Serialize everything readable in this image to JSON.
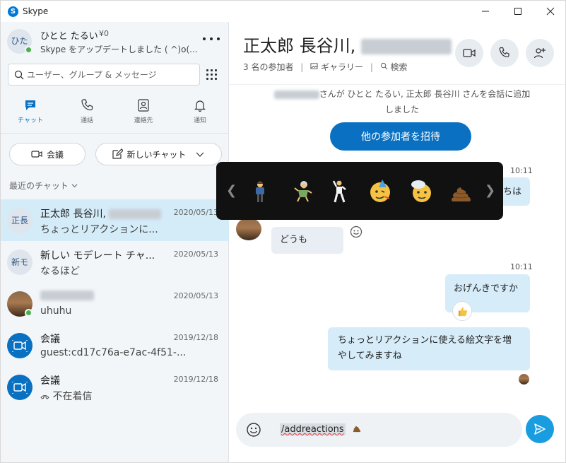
{
  "app": {
    "title": "Skype",
    "logo_letter": "S"
  },
  "profile": {
    "avatar_initials": "ひた",
    "name": "ひとと たるい",
    "credit": "¥0",
    "status": "Skype をアップデートしました ( ^)o(..."
  },
  "search": {
    "placeholder": "ユーザー、グループ & メッセージ"
  },
  "nav": [
    {
      "label": "チャット",
      "icon": "chat-icon"
    },
    {
      "label": "通話",
      "icon": "phone-icon"
    },
    {
      "label": "連絡先",
      "icon": "contacts-icon"
    },
    {
      "label": "通知",
      "icon": "bell-icon"
    }
  ],
  "actions": {
    "meeting": "会議",
    "new_chat": "新しいチャット"
  },
  "recent_label": "最近のチャット",
  "chats": [
    {
      "initials": "正長",
      "name": "正太郎 長谷川,",
      "date": "2020/05/13",
      "msg": "ちょっとリアクションに..."
    },
    {
      "initials": "新モ",
      "name": "新しい モデレート チャ...",
      "date": "2020/05/13",
      "msg": "なるほど"
    },
    {
      "initials": "",
      "name": "",
      "date": "2020/05/13",
      "msg": "uhuhu"
    },
    {
      "initials": "",
      "name": "会議",
      "date": "2019/12/18",
      "msg": "guest:cd17c76a-e7ac-4f51-..."
    },
    {
      "initials": "",
      "name": "会議",
      "date": "2019/12/18",
      "msg": "不在着信"
    }
  ],
  "conversation": {
    "title": "正太郎 長谷川,",
    "participants": "3 名の参加者",
    "gallery": "ギャラリー",
    "search": "検索",
    "system_msg": "さんが ひとと たるい, 正太郎 長谷川 さんを会話に追加しました",
    "invite_button": "他の参加者を招待",
    "msg1_time": "10:11",
    "msg1_partial": "ちは",
    "msg2_text": "どうも",
    "msg3_time": "10:11",
    "msg3_text": "おげんきですか",
    "msg4_text": "ちょっとリアクションに使える絵文字を増やしてみますね"
  },
  "composer": {
    "command": "/addreactions"
  },
  "emoji_popup": [
    "person-bowing",
    "old-woman-dancing",
    "man-dancing",
    "party-face",
    "mind-blown",
    "poop"
  ],
  "colors": {
    "accent": "#0a70c2",
    "send": "#1a9de0",
    "selected": "#d4ebf8"
  }
}
